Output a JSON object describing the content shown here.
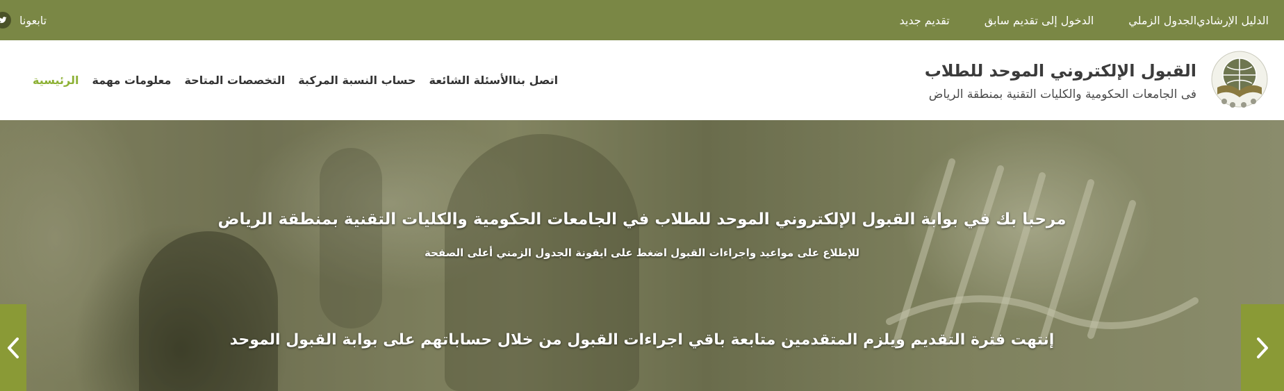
{
  "topbar": {
    "items": [
      "تقديم جديد",
      "الدخول إلى تقديم سابق",
      "الجدول الزملي",
      "الدليل الإرشادي"
    ],
    "follow_label": "تابعونا"
  },
  "header": {
    "brand_title": "القبول الإلكتروني الموحد للطلاب",
    "brand_subtitle": "فى الجامعات الحكومية والكليات التقنية بمنطقة الرياض",
    "nav": [
      {
        "label": "الرئيسية",
        "active": true
      },
      {
        "label": "معلومات مهمة",
        "active": false
      },
      {
        "label": "التخصصات المتاحة",
        "active": false
      },
      {
        "label": "حساب النسبة المركبة",
        "active": false
      },
      {
        "label": "الأسئلة الشائعة",
        "active": false
      },
      {
        "label": "اتصل بنا",
        "active": false
      }
    ]
  },
  "hero": {
    "line1": "مرحبا بك في بوابة القبول الإلكتروني الموحد للطلاب في الجامعات الحكومية والكليات التقنية بمنطقة الرياض",
    "line2": "للإطلاع على مواعيد واجراءات القبول اضغط على ايقونة الجدول الزمني أعلى الصفحة",
    "line3": "إنتهت فترة التقديم ويلزم المتقدمين متابعة باقي اجراءات القبول من خلال حساباتهم على بوابة القبول الموحد"
  },
  "colors": {
    "topbar": "#7a8745",
    "accent_active": "#8db135",
    "arrow_bg": "#8a9a36"
  },
  "icons": {
    "twitter": "twitter-icon",
    "prev": "chevron-left-icon",
    "next": "chevron-right-icon",
    "logo": "globe-book-logo"
  }
}
